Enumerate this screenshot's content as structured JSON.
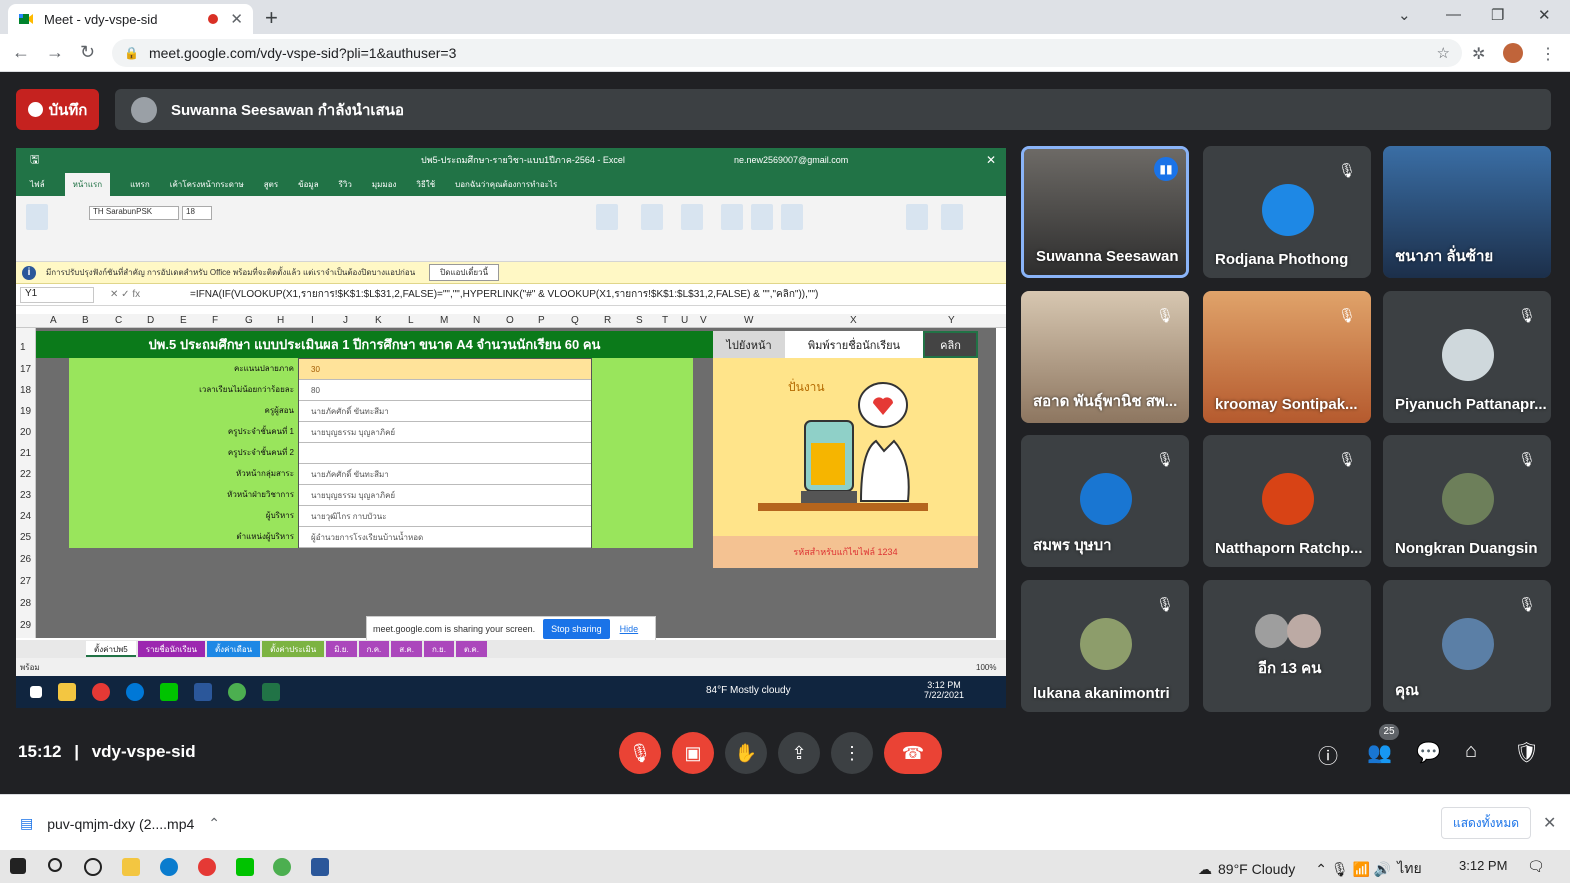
{
  "browser": {
    "tab_title": "Meet - vdy-vspe-sid",
    "url": "meet.google.com/vdy-vspe-sid?pli=1&authuser=3"
  },
  "meet": {
    "record_label": "บันทึก",
    "presenting_text": "Suwanna Seesawan กำลังนำเสนอ",
    "time": "15:12",
    "meeting_code": "vdy-vspe-sid",
    "participants_count": "25",
    "participants": [
      {
        "name": "Suwanna Seesawan",
        "active": true
      },
      {
        "name": "Rodjana Phothong"
      },
      {
        "name": "ชนาภา ลั่นซ้าย"
      },
      {
        "name": "สอาด พันธุ์พานิช สพ..."
      },
      {
        "name": "kroomay Sontipak..."
      },
      {
        "name": "Piyanuch Pattanapr..."
      },
      {
        "name": "สมพร บุษบา"
      },
      {
        "name": "Natthaporn Ratchp..."
      },
      {
        "name": "Nongkran Duangsin"
      },
      {
        "name": "lukana akanimontri"
      },
      {
        "name": "อีก 13 คน"
      },
      {
        "name": "คุณ"
      }
    ]
  },
  "excel": {
    "title": "ปพ5-ประถมศึกษา-รายวิชา-แบบ1ปีภาค-2564 - Excel",
    "user": "ne.new2569007@gmail.com",
    "menu": [
      "ไฟล์",
      "หน้าแรก",
      "แทรก",
      "เค้าโครงหน้ากระดาษ",
      "สูตร",
      "ข้อมูล",
      "รีวิว",
      "มุมมอง",
      "วิธีใช้",
      "บอกฉันว่าคุณต้องการทำอะไร"
    ],
    "font_name": "TH SarabunPSK",
    "font_size": "18",
    "info_text": "มีการปรับปรุงฟังก์ชันที่สำคัญ การอัปเดตสำหรับ Office พร้อมที่จะติดตั้งแล้ว แต่เราจำเป็นต้องปิดบางแอปก่อน",
    "info_button": "ปิดแอปเดี๋ยวนี้",
    "cell_ref": "Y1",
    "formula": "=IFNA(IF(VLOOKUP(X1,รายการ!$K$1:$L$31,2,FALSE)=\"\",\"\",HYPERLINK(\"#\" & VLOOKUP(X1,รายการ!$K$1:$L$31,2,FALSE) & \"\",\"คลิก\")),\"\")",
    "columns": [
      "A",
      "B",
      "C",
      "D",
      "E",
      "F",
      "G",
      "H",
      "I",
      "J",
      "K",
      "L",
      "M",
      "N",
      "O",
      "P",
      "Q",
      "R",
      "S",
      "T",
      "U",
      "V",
      "W",
      "X",
      "Y"
    ],
    "rows": [
      "1",
      "17",
      "18",
      "19",
      "20",
      "21",
      "22",
      "23",
      "24",
      "25",
      "26",
      "27",
      "28",
      "29"
    ],
    "header_title": "ปพ.5 ประถมศึกษา แบบประเมินผล 1 ปีการศึกษา ขนาด A4 จำนวนนักเรียน 60 คน",
    "btn_next": "ไปยังหน้า",
    "btn_search": "พิมพ์รายชื่อนักเรียน",
    "btn_click": "คลิก",
    "labels": [
      "คะแนนปลายภาค",
      "เวลาเรียนไม่น้อยกว่าร้อยละ",
      "ครูผู้สอน",
      "ครูประจำชั้นคนที่ 1",
      "ครูประจำชั้นคนที่ 2",
      "หัวหน้ากลุ่มสาระ",
      "หัวหน้าฝ่ายวิชาการ",
      "ผู้บริหาร",
      "ตำแหน่งผู้บริหาร"
    ],
    "values": [
      "30",
      "80",
      "นายภัคศักดิ์ ขันทะสีมา",
      "นายบุญธรรม บุญลาภิคย์",
      "",
      "นายภัคศักดิ์ ขันทะสีมา",
      "นายบุญธรรม บุญลาภิคย์",
      "นายวุฒิไกร กาบบัวนะ",
      "ผู้อำนวยการโรงเรียนบ้านน้ำหอด"
    ],
    "image_title": "ปั่นงาน",
    "image_footer": "รหัสสำหรับแก้ไขไฟล์ 1234",
    "share_text": "meet.google.com is sharing your screen.",
    "stop_sharing": "Stop sharing",
    "hide": "Hide",
    "sheet_tabs": [
      "ตั้งค่าปพ5",
      "รายชื่อนักเรียน",
      "ตั้งค่าเดือน",
      "ตั้งค่าประเมิน",
      "มิ.ย.",
      "ก.ค.",
      "ส.ค.",
      "ก.ย.",
      "ต.ค."
    ],
    "status_left": "พร้อม",
    "zoom": "100%",
    "weather": "84°F  Mostly cloudy",
    "clock_time": "3:12 PM",
    "clock_date": "7/22/2021"
  },
  "downloads": {
    "file": "puv-qmjm-dxy (2....mp4",
    "show_all": "แสดงทั้งหมด"
  },
  "taskbar": {
    "weather": "89°F  Cloudy",
    "lang": "ไทย",
    "time": "3:12 PM"
  }
}
